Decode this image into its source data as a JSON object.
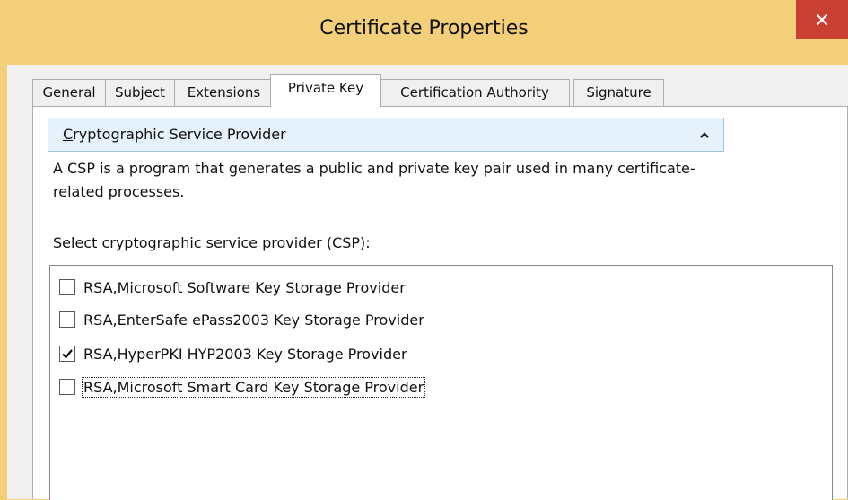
{
  "window": {
    "title": "Certificate Properties"
  },
  "tabs": [
    {
      "label": "General"
    },
    {
      "label": "Subject"
    },
    {
      "label": "Extensions"
    },
    {
      "label": "Private Key",
      "active": true
    },
    {
      "label": "Certification Authority"
    },
    {
      "label": "Signature"
    }
  ],
  "section": {
    "title_mnemonic": "C",
    "title_rest": "ryptographic Service Provider",
    "description": "A CSP is a program that generates a public and private key pair used in many certificate-related processes.",
    "prompt": "Select cryptographic service provider (CSP):"
  },
  "providers": [
    {
      "label": "RSA,Microsoft Software Key Storage Provider",
      "checked": false
    },
    {
      "label": "RSA,EnterSafe ePass2003 Key Storage Provider",
      "checked": false
    },
    {
      "label": "RSA,HyperPKI HYP2003 Key Storage Provider",
      "checked": true
    },
    {
      "label": "RSA,Microsoft Smart Card Key Storage Provider",
      "checked": false,
      "focused": true
    }
  ],
  "colors": {
    "frame": "#f3cf7a",
    "close_button": "#c84031",
    "section_header_bg": "#e5f1fb",
    "section_header_border": "#9cc3e5"
  }
}
